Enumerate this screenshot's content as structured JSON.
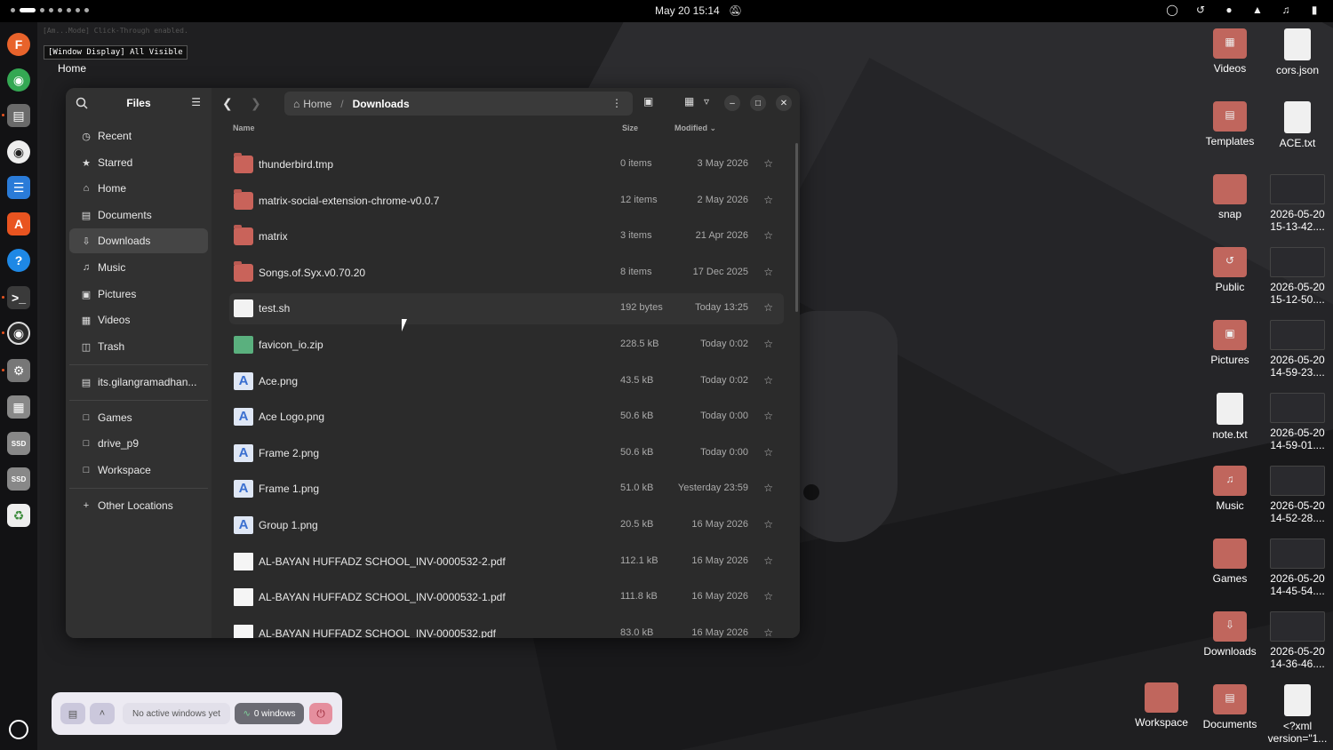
{
  "topbar": {
    "clock": "May 20  15:14"
  },
  "overlay": {
    "mode_text": "[Am...Mode] Click-Through enabled.",
    "window_display": "[Window Display] All Visible",
    "home_label": "Home"
  },
  "files": {
    "title": "Files",
    "sidebar": {
      "items": [
        {
          "label": "Recent",
          "icon": "clock-icon"
        },
        {
          "label": "Starred",
          "icon": "star-icon"
        },
        {
          "label": "Home",
          "icon": "home-icon"
        },
        {
          "label": "Documents",
          "icon": "document-icon"
        },
        {
          "label": "Downloads",
          "icon": "download-icon"
        },
        {
          "label": "Music",
          "icon": "music-icon"
        },
        {
          "label": "Pictures",
          "icon": "picture-icon"
        },
        {
          "label": "Videos",
          "icon": "video-icon"
        },
        {
          "label": "Trash",
          "icon": "trash-icon"
        }
      ],
      "drive": "its.gilangramadhan...",
      "bookmarks": [
        "Games",
        "drive_p9",
        "Workspace"
      ],
      "other": "Other Locations"
    },
    "path": {
      "home": "Home",
      "current": "Downloads"
    },
    "columns": {
      "name": "Name",
      "size": "Size",
      "modified": "Modified"
    },
    "rows": [
      {
        "name": "thunderbird.tmp",
        "size": "0 items",
        "modified": "3 May 2026",
        "type": "folder"
      },
      {
        "name": "matrix-social-extension-chrome-v0.0.7",
        "size": "12 items",
        "modified": "2 May 2026",
        "type": "folder"
      },
      {
        "name": "matrix",
        "size": "3 items",
        "modified": "21 Apr 2026",
        "type": "folder"
      },
      {
        "name": "Songs.of.Syx.v0.70.20",
        "size": "8 items",
        "modified": "17 Dec 2025",
        "type": "folder"
      },
      {
        "name": "test.sh",
        "size": "192 bytes",
        "modified": "Today 13:25",
        "type": "script"
      },
      {
        "name": "favicon_io.zip",
        "size": "228.5 kB",
        "modified": "Today 0:02",
        "type": "zip"
      },
      {
        "name": "Ace.png",
        "size": "43.5 kB",
        "modified": "Today 0:02",
        "type": "image"
      },
      {
        "name": "Ace Logo.png",
        "size": "50.6 kB",
        "modified": "Today 0:00",
        "type": "image"
      },
      {
        "name": "Frame 2.png",
        "size": "50.6 kB",
        "modified": "Today 0:00",
        "type": "image"
      },
      {
        "name": "Frame 1.png",
        "size": "51.0 kB",
        "modified": "Yesterday 23:59",
        "type": "image"
      },
      {
        "name": "Group 1.png",
        "size": "20.5 kB",
        "modified": "16 May 2026",
        "type": "image"
      },
      {
        "name": "AL-BAYAN HUFFADZ SCHOOL_INV-0000532-2.pdf",
        "size": "112.1 kB",
        "modified": "16 May 2026",
        "type": "pdf"
      },
      {
        "name": "AL-BAYAN HUFFADZ SCHOOL_INV-0000532-1.pdf",
        "size": "111.8 kB",
        "modified": "16 May 2026",
        "type": "pdf"
      },
      {
        "name": "AL-BAYAN HUFFADZ SCHOOL_INV-0000532.pdf",
        "size": "83.0 kB",
        "modified": "16 May 2026",
        "type": "pdf"
      }
    ]
  },
  "desktop": {
    "col1": [
      {
        "label": "Videos",
        "kind": "folder"
      },
      {
        "label": "Templates",
        "kind": "folder"
      },
      {
        "label": "snap",
        "kind": "folder"
      },
      {
        "label": "Public",
        "kind": "folder"
      },
      {
        "label": "Pictures",
        "kind": "folder"
      },
      {
        "label": "note.txt",
        "kind": "doc"
      },
      {
        "label": "Music",
        "kind": "folder"
      },
      {
        "label": "Games",
        "kind": "folder"
      },
      {
        "label": "Downloads",
        "kind": "folder"
      },
      {
        "label": "Documents",
        "kind": "folder"
      }
    ],
    "col2": [
      {
        "label": "cors.json",
        "kind": "doc"
      },
      {
        "label": "ACE.txt",
        "kind": "doc"
      },
      {
        "label": "2026-05-20 15-13-42....",
        "kind": "thumb"
      },
      {
        "label": "2026-05-20 15-12-50....",
        "kind": "thumb"
      },
      {
        "label": "2026-05-20 14-59-23....",
        "kind": "thumb"
      },
      {
        "label": "2026-05-20 14-59-01....",
        "kind": "thumb"
      },
      {
        "label": "2026-05-20 14-52-28....",
        "kind": "thumb"
      },
      {
        "label": "2026-05-20 14-45-54....",
        "kind": "thumb"
      },
      {
        "label": "2026-05-20 14-36-46....",
        "kind": "thumb"
      },
      {
        "label": "<?xml version=\"1...",
        "kind": "doc"
      }
    ],
    "workspace": "Workspace"
  },
  "widget": {
    "status": "No active windows yet",
    "windows": "0 windows"
  },
  "colors": {
    "folder": "#c9635a",
    "accent": "#e95420"
  }
}
